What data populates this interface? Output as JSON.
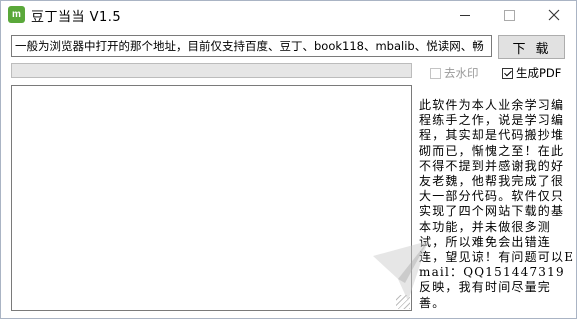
{
  "window": {
    "title": "豆丁当当   V1.5",
    "app_icon_glyph": "m",
    "controls": {
      "minimize": "minimize-icon",
      "maximize": "maximize-icon",
      "close": "close-icon"
    }
  },
  "toolbar": {
    "url_value": "一般为浏览器中打开的那个地址，目前仅支持百度、豆丁、book118、mbalib、悦读网、畅",
    "download_label": "下载"
  },
  "progress": {
    "value": 0
  },
  "options": {
    "remove_watermark": {
      "label": "去水印",
      "checked": false,
      "enabled": false
    },
    "generate_pdf": {
      "label": "生成PDF",
      "checked": true,
      "enabled": true
    }
  },
  "log": {
    "text": ""
  },
  "description": "此软件为本人业余学习编程练手之作，说是学习编程，其实却是代码搬抄堆砌而已，惭愧之至！在此不得不提到并感谢我的好友老魏，他帮我完成了很大一部分代码。软件仅只实现了四个网站下载的基本功能，并未做很多测试，所以难免会出错连连，望见谅！有问题可以Email：QQ151447319反映，我有时间尽量完善。",
  "colors": {
    "progress_fill": "#06b025",
    "app_icon": "#5aa83a"
  }
}
